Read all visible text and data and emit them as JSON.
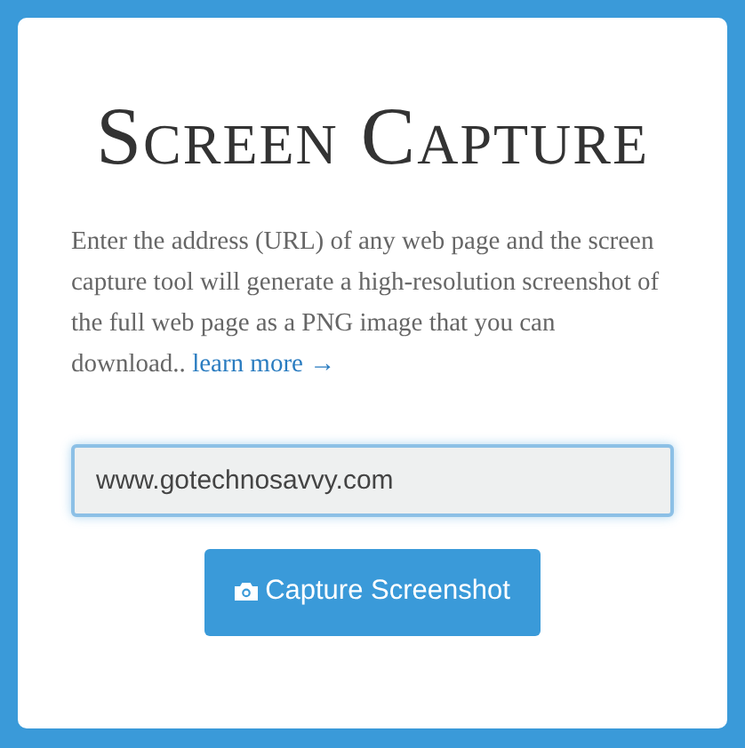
{
  "title": "Screen Capture",
  "description": {
    "text": "Enter the address (URL) of any web page and the screen capture tool will generate a high-resolution screenshot of the full web page as a PNG image that you can download.. ",
    "link": "learn more →"
  },
  "url_field": {
    "value": "www.gotechnosavvy.com"
  },
  "button": {
    "label": "Capture Screenshot"
  }
}
